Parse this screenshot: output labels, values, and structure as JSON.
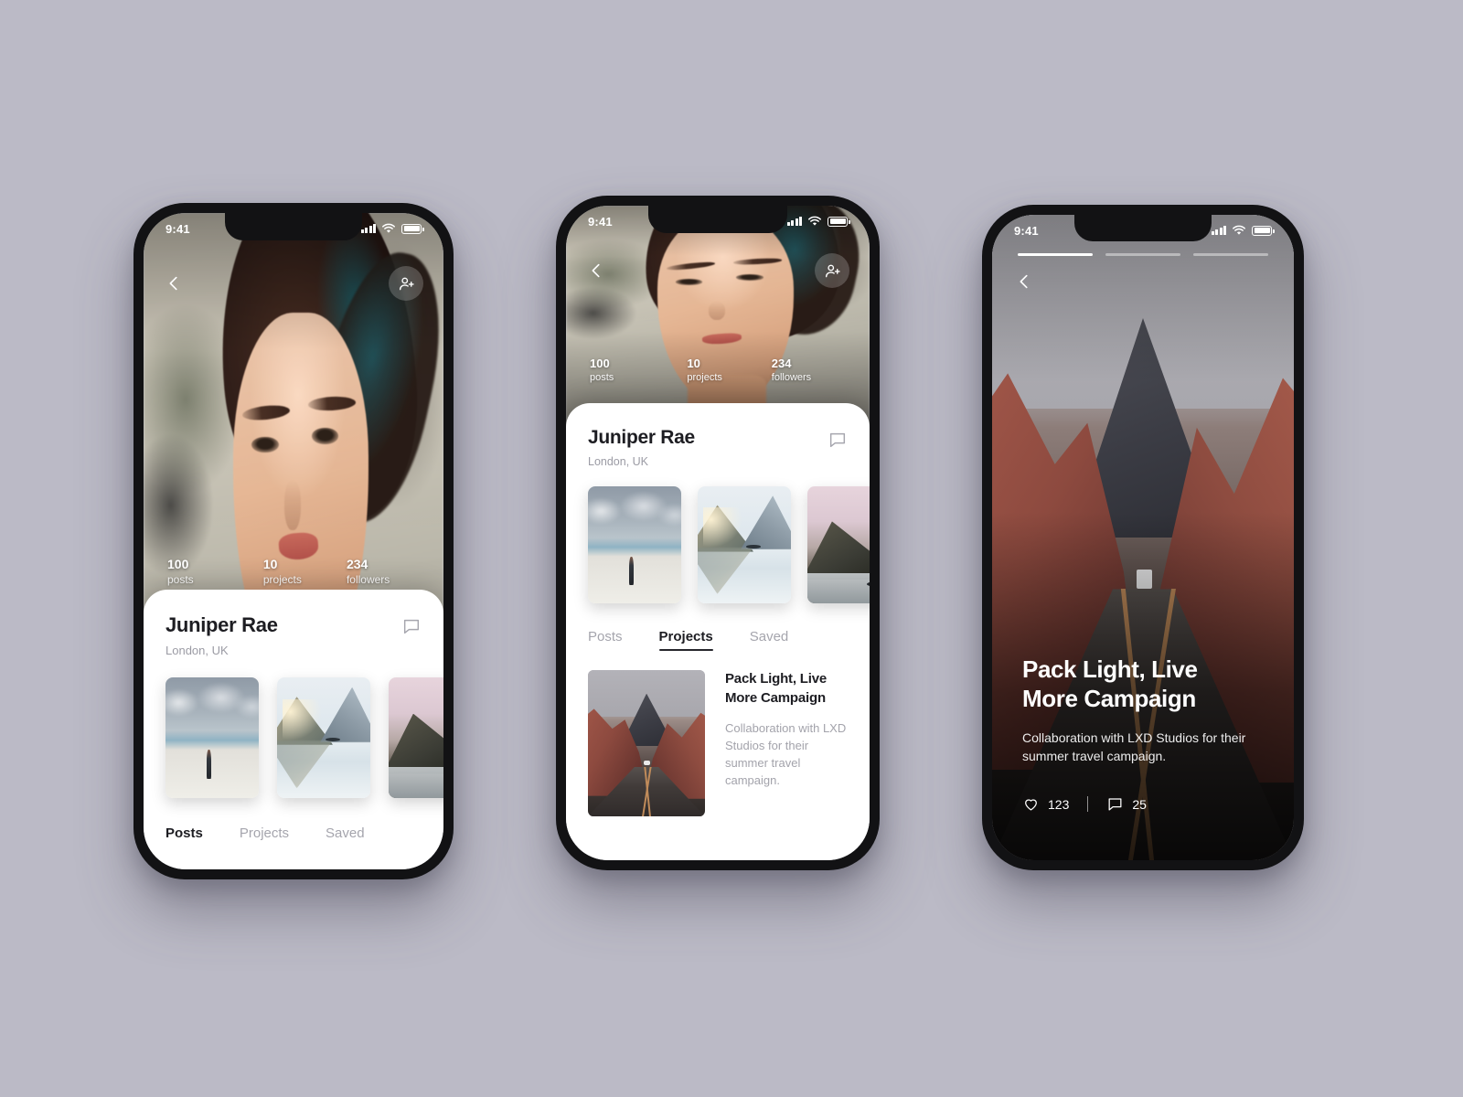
{
  "background_color": "#bbbac6",
  "status_bar": {
    "time": "9:41",
    "signal_icon": "signal-bars-icon",
    "wifi_icon": "wifi-icon",
    "battery_icon": "battery-icon"
  },
  "profile": {
    "name": "Juniper Rae",
    "location": "London, UK",
    "back_icon": "chevron-left-icon",
    "add_friend_icon": "add-person-icon",
    "message_icon": "message-bubble-icon",
    "stats": [
      {
        "value": "100",
        "label": "posts"
      },
      {
        "value": "10",
        "label": "projects"
      },
      {
        "value": "234",
        "label": "followers"
      }
    ],
    "tabs": [
      {
        "label": "Posts"
      },
      {
        "label": "Projects"
      },
      {
        "label": "Saved"
      }
    ],
    "thumbnails": [
      {
        "alt": "person standing on salt flat under clouds"
      },
      {
        "alt": "canoe on misty mountain lake at sunrise"
      },
      {
        "alt": "kayaker below pink mountain ridge"
      }
    ]
  },
  "screen_one": {
    "active_tab": "Posts"
  },
  "screen_two": {
    "active_tab": "Projects",
    "project": {
      "title": "Pack Light, Live More Campaign",
      "description": "Collaboration with LXD Studios for their summer travel campaign.",
      "thumb_alt": "desert highway between red rock canyon walls"
    }
  },
  "screen_three": {
    "back_icon": "chevron-left-icon",
    "progress_segments": 3,
    "active_segment": 1,
    "title": "Pack Light, Live More Campaign",
    "description": "Collaboration with LXD Studios for their summer travel campaign.",
    "like_icon": "heart-icon",
    "like_count": "123",
    "comment_icon": "comment-bubble-icon",
    "comment_count": "25",
    "photo_alt": "desert highway between red rock canyon walls toward dark mountain"
  }
}
